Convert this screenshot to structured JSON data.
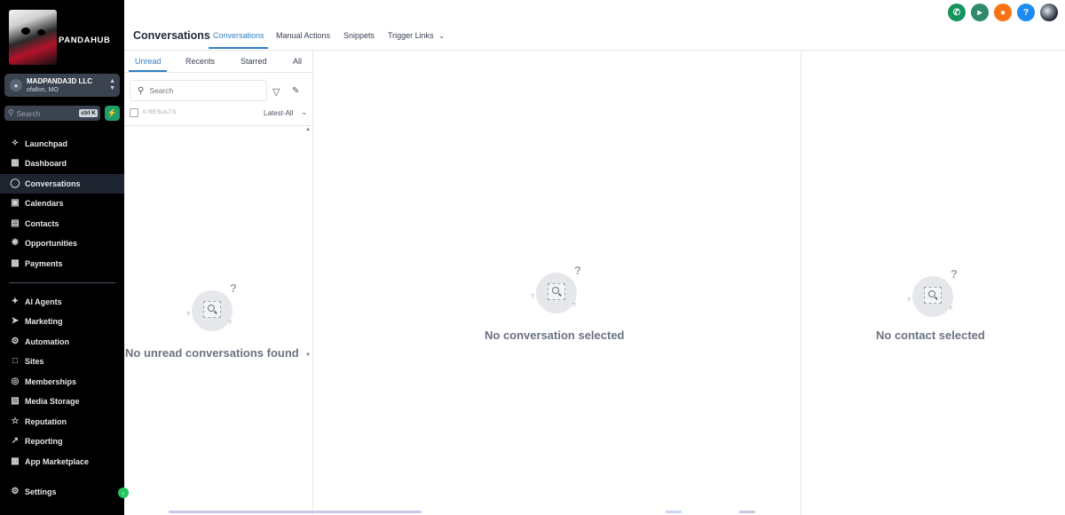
{
  "brand": {
    "name": "PANDAHUB"
  },
  "account": {
    "name": "MADPANDA3D LLC",
    "location": "ofallon, MO"
  },
  "sidebar_search": {
    "placeholder": "Search",
    "shortcut": "ctrl K"
  },
  "nav": {
    "primary": [
      {
        "label": "Launchpad",
        "icon": "rocket-icon"
      },
      {
        "label": "Dashboard",
        "icon": "dashboard-icon"
      },
      {
        "label": "Conversations",
        "icon": "chat-bubble-icon",
        "active": true
      },
      {
        "label": "Calendars",
        "icon": "calendar-icon"
      },
      {
        "label": "Contacts",
        "icon": "contacts-icon"
      },
      {
        "label": "Opportunities",
        "icon": "opportunities-icon"
      },
      {
        "label": "Payments",
        "icon": "payments-icon"
      }
    ],
    "secondary": [
      {
        "label": "AI Agents",
        "icon": "sparkle-icon"
      },
      {
        "label": "Marketing",
        "icon": "send-icon"
      },
      {
        "label": "Automation",
        "icon": "automation-icon"
      },
      {
        "label": "Sites",
        "icon": "sites-icon"
      },
      {
        "label": "Memberships",
        "icon": "membership-icon"
      },
      {
        "label": "Media Storage",
        "icon": "image-icon"
      },
      {
        "label": "Reputation",
        "icon": "star-icon"
      },
      {
        "label": "Reporting",
        "icon": "trend-icon"
      },
      {
        "label": "App Marketplace",
        "icon": "grid-icon"
      }
    ],
    "settings": {
      "label": "Settings",
      "icon": "gear-icon"
    }
  },
  "header": {
    "title": "Conversations",
    "tabs": [
      "Conversations",
      "Manual Actions",
      "Snippets",
      "Trigger Links"
    ],
    "active_tab": "Conversations"
  },
  "list": {
    "tabs": [
      "Unread",
      "Recents",
      "Starred",
      "All"
    ],
    "active_tab": "Unread",
    "search_placeholder": "Search",
    "results": "0 RESULTS",
    "sort": "Latest-All",
    "empty_message": "No unread conversations found"
  },
  "center": {
    "empty_message": "No conversation selected"
  },
  "contact": {
    "empty_message": "No contact selected"
  },
  "colors": {
    "sidebar_bg": "#000000",
    "accent": "#2f80c6",
    "phone": "#15935c",
    "bell": "#f97316",
    "help": "#1d8cf0"
  }
}
